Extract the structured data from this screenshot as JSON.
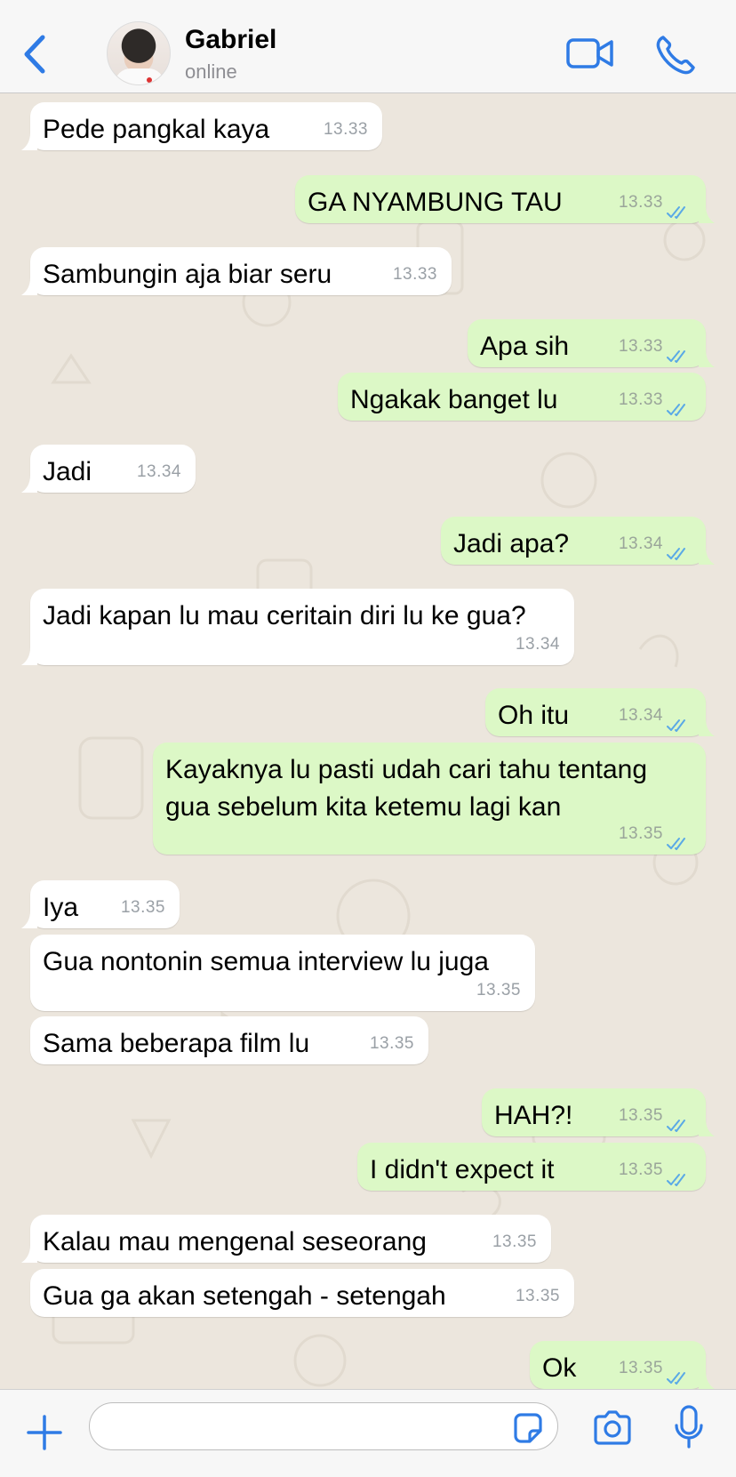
{
  "header": {
    "contact_name": "Gabriel",
    "status": "online",
    "icons": [
      "chevron-left-icon",
      "avatar",
      "video-call-icon",
      "phone-icon"
    ]
  },
  "colors": {
    "accent": "#2f7be5",
    "incoming_bubble": "#ffffff",
    "outgoing_bubble": "#dcf8c6",
    "chat_background": "#ece6dd",
    "read_tick": "#5aa9e6"
  },
  "messages": [
    {
      "dir": "in",
      "text": "Pede pangkal kaya",
      "time": "13.33"
    },
    {
      "dir": "out",
      "text": "GA NYAMBUNG TAU",
      "time": "13.33"
    },
    {
      "dir": "in",
      "text": "Sambungin aja biar seru",
      "time": "13.33"
    },
    {
      "dir": "out",
      "text": "Apa sih",
      "time": "13.33"
    },
    {
      "dir": "out",
      "text": "Ngakak banget lu",
      "time": "13.33"
    },
    {
      "dir": "in",
      "text": "Jadi",
      "time": "13.34"
    },
    {
      "dir": "out",
      "text": "Jadi apa?",
      "time": "13.34"
    },
    {
      "dir": "in",
      "text": "Jadi kapan lu mau ceritain diri lu ke gua?",
      "time": "13.34"
    },
    {
      "dir": "out",
      "text": "Oh itu",
      "time": "13.34"
    },
    {
      "dir": "out",
      "text": "Kayaknya lu pasti udah cari tahu tentang\ngua sebelum kita ketemu lagi kan",
      "time": "13.35"
    },
    {
      "dir": "in",
      "text": "Iya",
      "time": "13.35"
    },
    {
      "dir": "in",
      "text": "Gua nontonin semua interview lu juga",
      "time": "13.35"
    },
    {
      "dir": "in",
      "text": "Sama beberapa film lu",
      "time": "13.35"
    },
    {
      "dir": "out",
      "text": "HAH?!",
      "time": "13.35"
    },
    {
      "dir": "out",
      "text": "I didn't expect it",
      "time": "13.35"
    },
    {
      "dir": "in",
      "text": "Kalau mau mengenal seseorang",
      "time": "13.35"
    },
    {
      "dir": "in",
      "text": "Gua ga akan setengah - setengah",
      "time": "13.35"
    },
    {
      "dir": "out",
      "text": "Ok",
      "time": "13.35"
    }
  ],
  "composer": {
    "placeholder": "",
    "icons": [
      "plus-icon",
      "sticker-icon",
      "camera-icon",
      "microphone-icon"
    ]
  }
}
